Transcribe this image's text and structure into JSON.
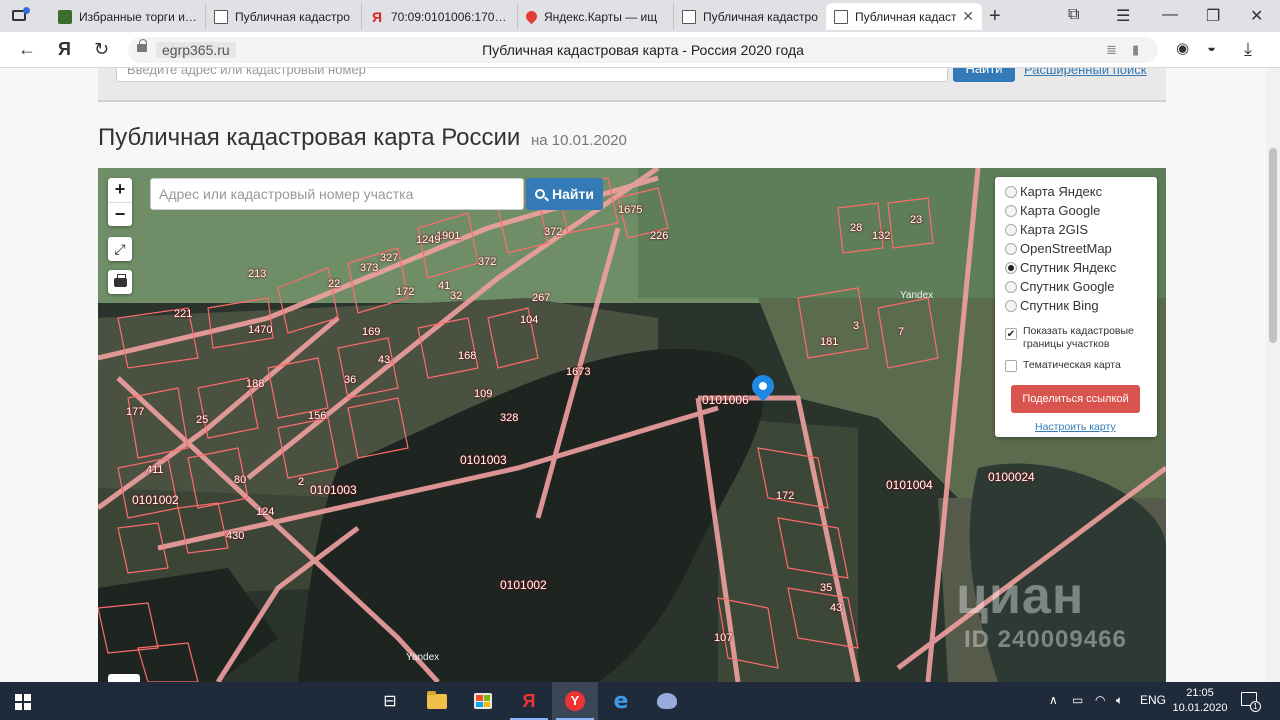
{
  "browser": {
    "tabs": [
      {
        "title": "Избранные торги и…",
        "icon": "green-square-icon"
      },
      {
        "title": "Публичная кадастро",
        "icon": "document-icon"
      },
      {
        "title": "70:09:0101006:170 —",
        "icon": "yandex-icon"
      },
      {
        "title": "Яндекс.Карты — ищ",
        "icon": "map-pin-icon"
      },
      {
        "title": "Публичная кадастро",
        "icon": "document-icon"
      },
      {
        "title": "Публичная кадаст",
        "icon": "document-icon",
        "active": true
      }
    ],
    "new_tab": "+",
    "address": {
      "yandex_logo": "Я",
      "domain": "egrp365.ru",
      "page_title": "Публичная кадастровая карта - Россия 2020 года"
    }
  },
  "page": {
    "top_search": {
      "placeholder": "Введите адрес или кадастровый номер",
      "button": "Найти",
      "advanced_link": "Расширенный поиск"
    },
    "heading": "Публичная кадастровая карта России",
    "heading_date": "на 10.01.2020"
  },
  "map": {
    "zoom_in": "+",
    "zoom_out": "−",
    "search_placeholder": "Адрес или кадастровый номер участка",
    "search_button": "Найти",
    "layers": [
      {
        "label": "Карта Яндекс",
        "selected": false
      },
      {
        "label": "Карта Google",
        "selected": false
      },
      {
        "label": "Карта 2GIS",
        "selected": false
      },
      {
        "label": "OpenStreetMap",
        "selected": false
      },
      {
        "label": "Спутник Яндекс",
        "selected": true
      },
      {
        "label": "Спутник Google",
        "selected": false
      },
      {
        "label": "Спутник Bing",
        "selected": false
      }
    ],
    "show_borders": {
      "label": "Показать кадастровые границы участков",
      "checked": true
    },
    "thematic_map": {
      "label": "Тематическая карта",
      "checked": false
    },
    "share_button": "Поделиться ссылкой",
    "setup_link": "Настроить карту",
    "quarter_labels": [
      "0101006",
      "0101003",
      "0101003",
      "0101002",
      "0101002",
      "0101004",
      "0100024"
    ],
    "parcel_numbers": [
      "1675",
      "372",
      "226",
      "28",
      "132",
      "23",
      "1901",
      "1249",
      "373",
      "327",
      "372",
      "213",
      "22",
      "41",
      "32",
      "172",
      "267",
      "221",
      "1470",
      "169",
      "104",
      "1673",
      "168",
      "43",
      "188",
      "36",
      "156",
      "109",
      "328",
      "2",
      "25",
      "181",
      "3",
      "7",
      "172",
      "35",
      "43",
      "107",
      "80",
      "411",
      "177",
      "124",
      "430"
    ],
    "yandex_marks": [
      "Yandex",
      "Yandex"
    ],
    "watermark": {
      "brand": "циан",
      "id": "ID 240009466"
    },
    "colors": {
      "parcel_border": "#ff6b6b",
      "road": "#f0a0a0",
      "water": "#1e2420",
      "field": "#6e8c67"
    }
  },
  "taskbar": {
    "language": "ENG",
    "time": "21:05",
    "date": "10.01.2020",
    "notifications": "1",
    "yandex_letter": "Я",
    "yandex_browser": "Y",
    "edge": "e"
  }
}
